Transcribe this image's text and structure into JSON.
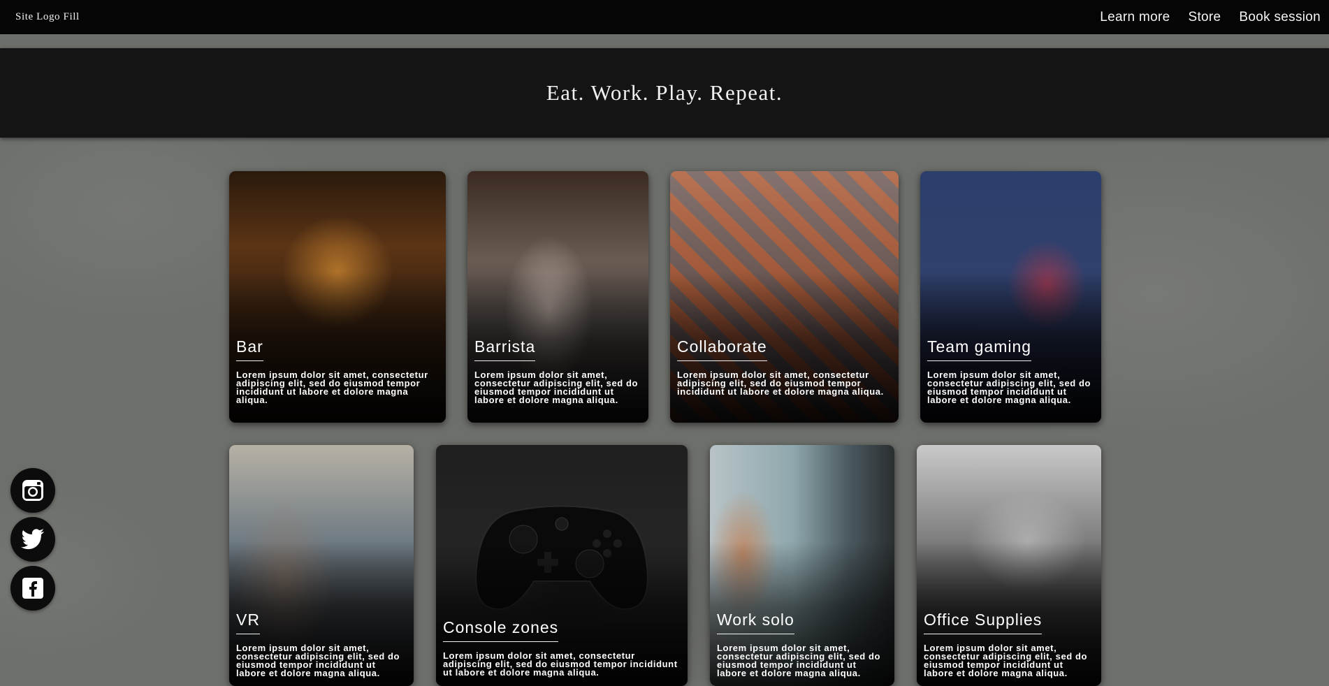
{
  "nav": {
    "logo": "Site Logo Fill",
    "links": [
      "Learn more",
      "Store",
      "Book session"
    ]
  },
  "hero": {
    "tagline": "Eat. Work. Play. Repeat."
  },
  "cards": [
    {
      "title": "Bar",
      "desc": "Lorem ipsum dolor sit amet, consectetur adipiscing elit, sed do eiusmod tempor incididunt ut labore et dolore magna aliqua."
    },
    {
      "title": "Barrista",
      "desc": "Lorem ipsum dolor sit amet, consectetur adipiscing elit, sed do eiusmod tempor incididunt ut labore et dolore magna aliqua."
    },
    {
      "title": "Collaborate",
      "desc": "Lorem ipsum dolor sit amet, consectetur adipiscing elit, sed do eiusmod tempor incididunt ut labore et dolore magna aliqua."
    },
    {
      "title": "Team gaming",
      "desc": "Lorem ipsum dolor sit amet, consectetur adipiscing elit, sed do eiusmod tempor incididunt ut labore et dolore magna aliqua."
    },
    {
      "title": "VR",
      "desc": "Lorem ipsum dolor sit amet, consectetur adipiscing elit, sed do eiusmod tempor incididunt ut labore et dolore magna aliqua."
    },
    {
      "title": "Console zones",
      "desc": "Lorem ipsum dolor sit amet, consectetur adipiscing elit, sed do eiusmod tempor incididunt ut labore et dolore magna aliqua."
    },
    {
      "title": "Work solo",
      "desc": "Lorem ipsum dolor sit amet, consectetur adipiscing elit, sed do eiusmod tempor incididunt ut labore et dolore magna aliqua."
    },
    {
      "title": "Office Supplies",
      "desc": "Lorem ipsum dolor sit amet, consectetur adipiscing elit, sed do eiusmod tempor incididunt ut labore et dolore magna aliqua."
    }
  ],
  "social": [
    "instagram-icon",
    "twitter-icon",
    "facebook-icon"
  ],
  "colors": {
    "nav_bg": "#050505",
    "hero_bg": "#141414",
    "page_bg": "#6d6f6b",
    "text": "#ffffff"
  }
}
